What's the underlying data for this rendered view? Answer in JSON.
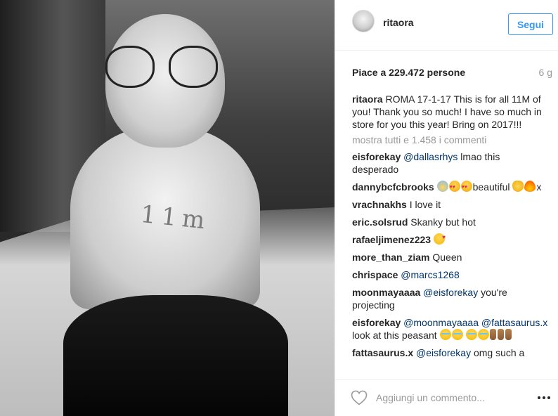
{
  "post": {
    "username": "ritaora",
    "follow_label": "Segui",
    "likes_text": "Piace a 229.472 persone",
    "time_ago": "6 g",
    "photo_text": "11m"
  },
  "caption": {
    "user": "ritaora",
    "text": "ROMA 17-1-17 This is for all 11M of you! Thank you so much! I have so much in store for you this year! Bring on 2017!!!"
  },
  "show_all_comments": "mostra tutti e 1.458 i commenti",
  "comments": [
    {
      "user": "eisforekay",
      "mention": "@dallasrhys",
      "text": " lmao this desperado"
    },
    {
      "user": "dannybcfcbrooks",
      "text": "beautiful",
      "after": "x"
    },
    {
      "user": "vrachnakhs",
      "text": "I love it"
    },
    {
      "user": "eric.solsrud",
      "text": "Skanky but hot"
    },
    {
      "user": "rafaeljimenez223",
      "text": ""
    },
    {
      "user": "more_than_ziam",
      "text": "Queen"
    },
    {
      "user": "chrispace",
      "mention": "@marcs1268"
    },
    {
      "user": "moonmayaaaa",
      "mention": "@eisforekay",
      "text": " you're projecting"
    },
    {
      "user": "eisforekay",
      "mention": "@moonmayaaaa",
      "mention2": "@fattasaurus.x",
      "text": " look at this peasant "
    },
    {
      "user": "fattasaurus.x",
      "mention": "@eisforekay",
      "text": " omg such a"
    }
  ],
  "footer": {
    "comment_placeholder": "Aggiungi un commento..."
  },
  "icons": {
    "like": "heart-outline-icon",
    "more": "more-options-icon"
  },
  "colors": {
    "link_blue": "#003569",
    "follow_blue": "#3897f0",
    "muted_gray": "#999999"
  }
}
